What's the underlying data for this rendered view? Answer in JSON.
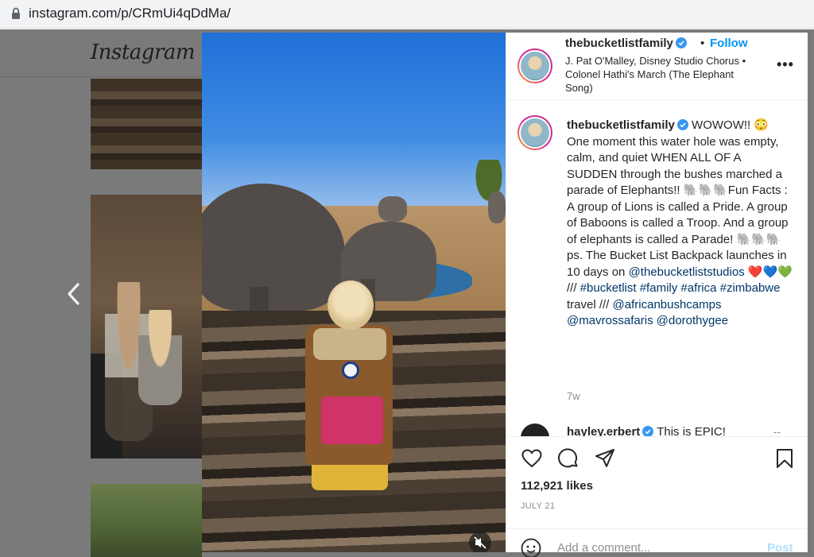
{
  "browser": {
    "url": "instagram.com/p/CRmUi4qDdMa/"
  },
  "app": {
    "logo": "Instagram"
  },
  "post": {
    "username": "thebucketlistfamily",
    "follow_separator": "•",
    "follow_label": "Follow",
    "audio_line": "J. Pat O'Malley, Disney Studio Chorus • Colonel Hathi's March (The Elephant Song)",
    "more_label": "•••",
    "caption": {
      "user": "thebucketlistfamily",
      "t1": "WOWOW!! 😳 One moment this water hole was empty, calm, and quiet WHEN ALL OF A SUDDEN through the bushes marched a parade of Elephants!! 🐘🐘🐘Fun Facts : A group of Lions is called a Pride. A group of Baboons is called a Troop. And a group of elephants is called a Parade! 🐘🐘🐘 ps. The Bucket List Backpack launches in 10 days on ",
      "m1": "@thebucketliststudios",
      "t2": " ❤️💙💚 /// ",
      "h1": "#bucketlist",
      "h2": "#family",
      "h3": "#africa",
      "h4": "#zimbabwe",
      "t3": " travel /// ",
      "m2": "@africanbushcamps",
      "m3": "@mavrossafaris",
      "m4": "@dorothygee"
    },
    "age": "7w",
    "comment": {
      "user": "hayley.erbert",
      "text": "This is EPIC!",
      "more": "--"
    },
    "likes": "112,921 likes",
    "date": "JULY 21",
    "add_comment_placeholder": "Add a comment...",
    "post_label": "Post"
  },
  "colors": {
    "link": "#00376b",
    "follow": "#0095f6",
    "post_disabled": "#b2dffc",
    "verified": "#3897f0"
  },
  "icons": [
    "lock-icon",
    "chevron-left-icon",
    "verified-icon",
    "more-icon",
    "heart-icon",
    "comment-icon",
    "share-icon",
    "bookmark-icon",
    "emoji-icon",
    "mute-icon"
  ]
}
